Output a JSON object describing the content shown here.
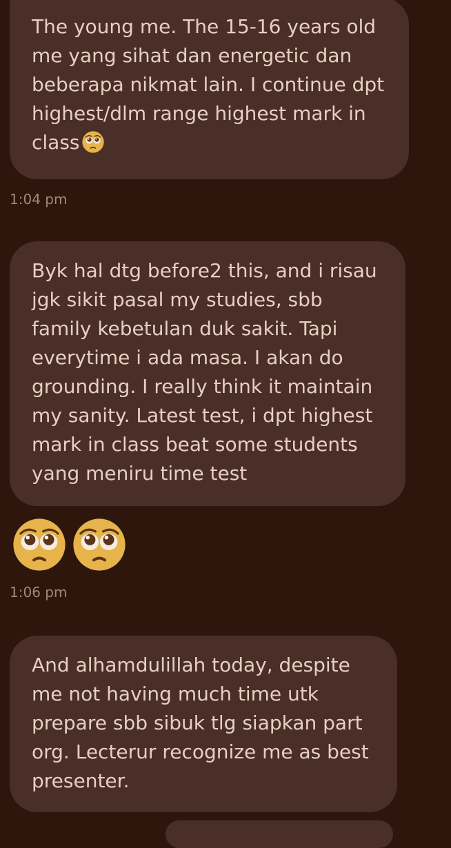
{
  "messages": [
    {
      "text": "The young me. The 15-16 years old me yang sihat dan energetic dan beberapa nikmat lain. I continue dpt highest/dlm range highest mark in class",
      "trailing_emoji": "pleading-face",
      "time": "1:04 pm"
    },
    {
      "text": "Byk hal dtg before2 this, and i risau jgk sikit pasal my studies, sbb family kebetulan duk sakit. Tapi everytime i ada masa. I akan do grounding. I really think it maintain my sanity. Latest test, i dpt highest mark in class beat some students yang meniru time test",
      "time": "1:06 pm"
    },
    {
      "text": "And alhamdulillah today, despite me not having much time utk prepare sbb sibuk tlg siapkan part org. Lecterur recognize me as best presenter.",
      "time": ""
    }
  ],
  "emoji_message": {
    "emojis": [
      "pleading-face",
      "pleading-face"
    ]
  },
  "colors": {
    "background": "#2e160d",
    "bubble": "#4a2f28",
    "text": "#e7cfc1",
    "timestamp": "#a3897f",
    "emoji_face": "#e7b44b"
  }
}
